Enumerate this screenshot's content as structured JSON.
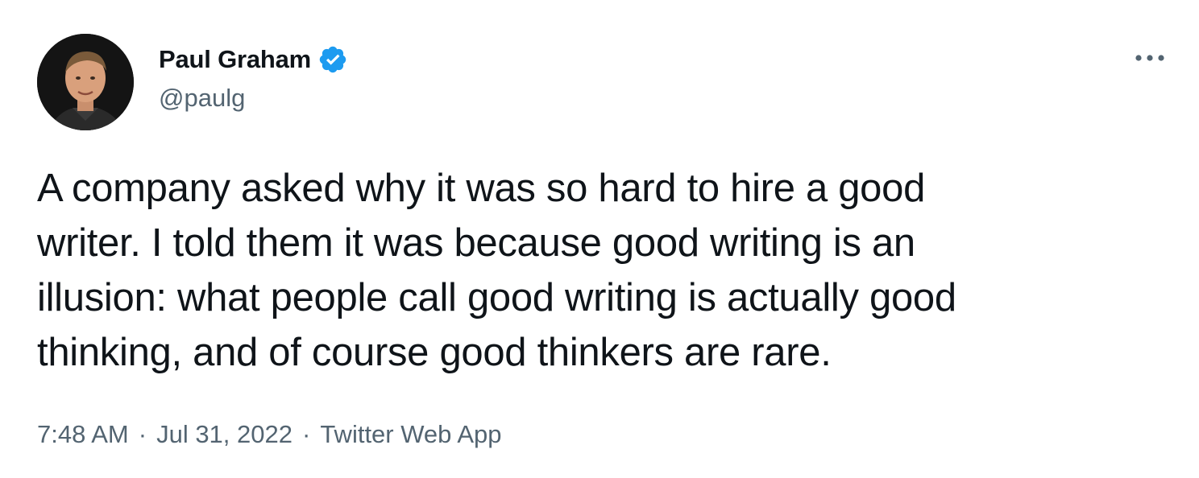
{
  "author": {
    "display_name": "Paul Graham",
    "handle": "@paulg",
    "verified": true,
    "avatar_icon": "profile-photo"
  },
  "menu_icon": "more-horizontal-icon",
  "tweet": {
    "text": "A company asked why it was so hard to hire a good\nwriter. I told them it was because good writing is an\nillusion: what people call good writing is actually good\nthinking, and of course good thinkers are rare."
  },
  "meta": {
    "time": "7:48 AM",
    "separator": "·",
    "date": "Jul 31, 2022",
    "source": "Twitter Web App"
  },
  "colors": {
    "text_primary": "#0f1419",
    "text_secondary": "#536471",
    "verified_blue": "#1d9bf0",
    "background": "#ffffff"
  }
}
